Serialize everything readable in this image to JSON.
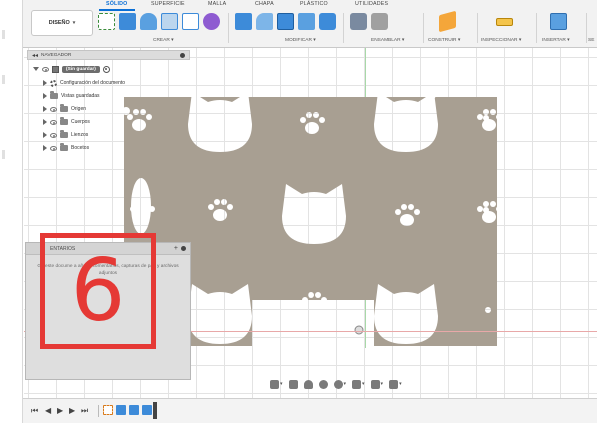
{
  "toolbar": {
    "design_button": "DISEÑO",
    "tabs": [
      "SÓLIDO",
      "SUPERFICIE",
      "MALLA",
      "CHAPA",
      "PLÁSTICO",
      "UTILIDADES"
    ],
    "groups": [
      "CREAR",
      "MODIFICAR",
      "ENSAMBLAR",
      "CONSTRUIR",
      "INSPECCIONAR",
      "INSERTAR",
      "SE"
    ]
  },
  "browser": {
    "title": "NAVEGADOR",
    "root": "(Sin guardar)",
    "items": [
      "Configuración del documento",
      "Vistas guardadas",
      "Origen",
      "Cuerpos",
      "Lienzos",
      "Bocetos"
    ]
  },
  "comments": {
    "title": "ENTARIOS",
    "body": "Gu este docume a añadir comentarios, capturas de pan y archivos adjuntos"
  },
  "badge": {
    "number": "6",
    "color": "#e53935"
  },
  "colors": {
    "accent": "#0a6fd6",
    "sketch_fill": "#a89f92",
    "canvas": "#ffffff"
  },
  "icons": {
    "timeline": [
      "skip-start-icon",
      "step-back-icon",
      "play-icon",
      "step-forward-icon",
      "skip-end-icon"
    ],
    "viewbar": [
      "orbit-icon",
      "look-at-icon",
      "pan-icon",
      "zoom-icon",
      "zoom-window-icon",
      "display-settings-icon",
      "grid-icon",
      "viewports-icon"
    ]
  }
}
